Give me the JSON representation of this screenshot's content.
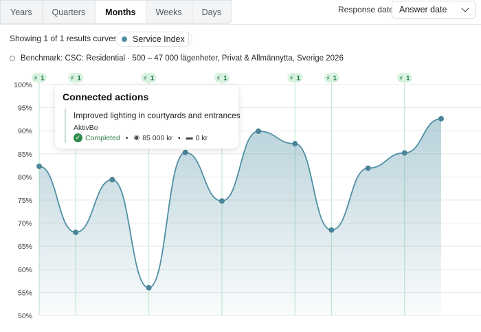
{
  "tabs": [
    {
      "label": "Years",
      "active": false
    },
    {
      "label": "Quarters",
      "active": false
    },
    {
      "label": "Months",
      "active": true
    },
    {
      "label": "Weeks",
      "active": false
    },
    {
      "label": "Days",
      "active": false
    }
  ],
  "response_date": {
    "label": "Response date",
    "selected": "Answer date"
  },
  "results": {
    "showing": "Showing 1 of 1 results curves",
    "series_label": "Service Index",
    "series_color": "#4f8fa3"
  },
  "benchmark": {
    "label": "Benchmark: CSC: Residential · 500 – 47 000 lägenheter, Privat & Allmännytta, Sverige 2026"
  },
  "tooltip": {
    "title": "Connected actions",
    "action": "Improved lighting in courtyards and entrances",
    "org": "AktivBo",
    "status": "Completed",
    "cost": "85 000 kr",
    "budget": "0 kr"
  },
  "chart_data": {
    "type": "area",
    "ylim": [
      50,
      100
    ],
    "yticks": [
      "100%",
      "95%",
      "90%",
      "85%",
      "80%",
      "75%",
      "70%",
      "65%",
      "60%",
      "55%",
      "50%"
    ],
    "grid": true,
    "series": [
      {
        "name": "Service Index",
        "color": "#4f8fa3",
        "values": [
          82.3,
          68.0,
          79.4,
          56.0,
          85.3,
          74.8,
          89.9,
          87.2,
          68.5,
          81.9,
          85.2,
          92.6
        ]
      }
    ],
    "action_markers": [
      {
        "point_index": 0,
        "count": "1"
      },
      {
        "point_index": 1,
        "count": "1"
      },
      {
        "point_index": 3,
        "count": "1"
      },
      {
        "point_index": 5,
        "count": "1"
      },
      {
        "point_index": 7,
        "count": "1"
      },
      {
        "point_index": 8,
        "count": "1"
      },
      {
        "point_index": 10,
        "count": "1"
      }
    ]
  }
}
